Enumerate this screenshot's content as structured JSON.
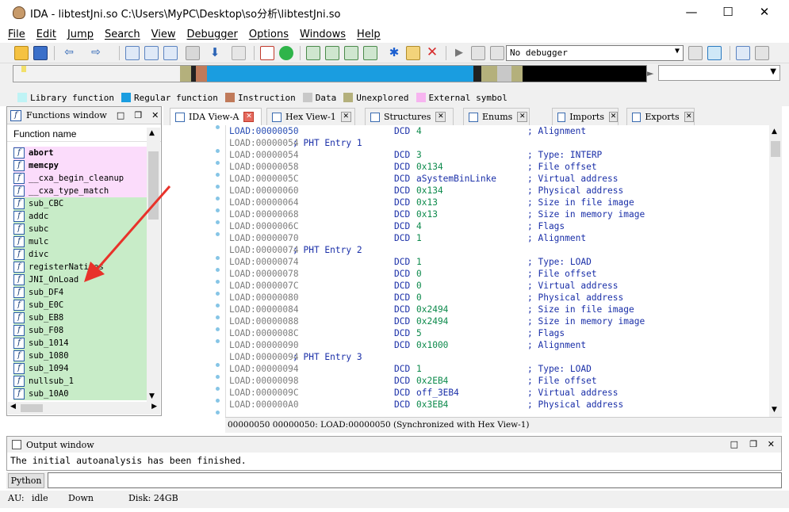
{
  "window": {
    "title": "IDA - libtestJni.so C:\\Users\\MyPC\\Desktop\\so分析\\libtestJni.so"
  },
  "menu": [
    "File",
    "Edit",
    "Jump",
    "Search",
    "View",
    "Debugger",
    "Options",
    "Windows",
    "Help"
  ],
  "toolbar": {
    "debugger_select": "No debugger"
  },
  "legend": [
    {
      "label": "Library function",
      "color": "#bff3f5"
    },
    {
      "label": "Regular function",
      "color": "#1a9de0"
    },
    {
      "label": "Instruction",
      "color": "#c07a5a"
    },
    {
      "label": "Data",
      "color": "#c8c8c8"
    },
    {
      "label": "Unexplored",
      "color": "#b4b07c"
    },
    {
      "label": "External symbol",
      "color": "#f7b4f0"
    }
  ],
  "functions_window": {
    "title": "Functions window",
    "column": "Function name",
    "items": [
      {
        "name": "abort",
        "bg": "#fbdcfb",
        "bold": true
      },
      {
        "name": "memcpy",
        "bg": "#fbdcfb",
        "bold": true
      },
      {
        "name": "__cxa_begin_cleanup",
        "bg": "#fbdcfb",
        "bold": false
      },
      {
        "name": "__cxa_type_match",
        "bg": "#fbdcfb",
        "bold": false
      },
      {
        "name": "sub_CBC",
        "bg": "#c8ecc8",
        "bold": false
      },
      {
        "name": "addc",
        "bg": "#c8ecc8",
        "bold": false
      },
      {
        "name": "subc",
        "bg": "#c8ecc8",
        "bold": false
      },
      {
        "name": "mulc",
        "bg": "#c8ecc8",
        "bold": false
      },
      {
        "name": "divc",
        "bg": "#c8ecc8",
        "bold": false
      },
      {
        "name": "registerNatives",
        "bg": "#c8ecc8",
        "bold": false
      },
      {
        "name": "JNI_OnLoad",
        "bg": "#c8ecc8",
        "bold": false
      },
      {
        "name": "sub_DF4",
        "bg": "#c8ecc8",
        "bold": false
      },
      {
        "name": "sub_E0C",
        "bg": "#c8ecc8",
        "bold": false
      },
      {
        "name": "sub_EB8",
        "bg": "#c8ecc8",
        "bold": false
      },
      {
        "name": "sub_F08",
        "bg": "#c8ecc8",
        "bold": false
      },
      {
        "name": "sub_1014",
        "bg": "#c8ecc8",
        "bold": false
      },
      {
        "name": "sub_1080",
        "bg": "#c8ecc8",
        "bold": false
      },
      {
        "name": "sub_1094",
        "bg": "#c8ecc8",
        "bold": false
      },
      {
        "name": "nullsub_1",
        "bg": "#c8ecc8",
        "bold": false
      },
      {
        "name": "sub_10A0",
        "bg": "#c8ecc8",
        "bold": false
      }
    ]
  },
  "tabs": [
    {
      "label": "IDA View-A",
      "active": true
    },
    {
      "label": "Hex View-1",
      "active": false
    },
    {
      "label": "Structures",
      "active": false
    },
    {
      "label": "Enums",
      "active": false
    },
    {
      "label": "Imports",
      "active": false
    },
    {
      "label": "Exports",
      "active": false
    }
  ],
  "disasm": [
    {
      "addr": "LOAD:00000050",
      "mnem": "DCD",
      "op": "4",
      "cmt": "; Alignment"
    },
    {
      "addr": "LOAD:00000054",
      "hdr": "; PHT Entry 1"
    },
    {
      "addr": "LOAD:00000054",
      "mnem": "DCD",
      "op": "3",
      "cmt": "; Type: INTERP"
    },
    {
      "addr": "LOAD:00000058",
      "mnem": "DCD",
      "op": "0x134",
      "cmt": "; File offset"
    },
    {
      "addr": "LOAD:0000005C",
      "mnem": "DCD",
      "op": "aSystemBinLinke",
      "cmt": "; Virtual address"
    },
    {
      "addr": "LOAD:00000060",
      "mnem": "DCD",
      "op": "0x134",
      "cmt": "; Physical address"
    },
    {
      "addr": "LOAD:00000064",
      "mnem": "DCD",
      "op": "0x13",
      "cmt": "; Size in file image"
    },
    {
      "addr": "LOAD:00000068",
      "mnem": "DCD",
      "op": "0x13",
      "cmt": "; Size in memory image"
    },
    {
      "addr": "LOAD:0000006C",
      "mnem": "DCD",
      "op": "4",
      "cmt": "; Flags"
    },
    {
      "addr": "LOAD:00000070",
      "mnem": "DCD",
      "op": "1",
      "cmt": "; Alignment"
    },
    {
      "addr": "LOAD:00000074",
      "hdr": "; PHT Entry 2"
    },
    {
      "addr": "LOAD:00000074",
      "mnem": "DCD",
      "op": "1",
      "cmt": "; Type: LOAD"
    },
    {
      "addr": "LOAD:00000078",
      "mnem": "DCD",
      "op": "0",
      "cmt": "; File offset"
    },
    {
      "addr": "LOAD:0000007C",
      "mnem": "DCD",
      "op": "0",
      "cmt": "; Virtual address"
    },
    {
      "addr": "LOAD:00000080",
      "mnem": "DCD",
      "op": "0",
      "cmt": "; Physical address"
    },
    {
      "addr": "LOAD:00000084",
      "mnem": "DCD",
      "op": "0x2494",
      "cmt": "; Size in file image"
    },
    {
      "addr": "LOAD:00000088",
      "mnem": "DCD",
      "op": "0x2494",
      "cmt": "; Size in memory image"
    },
    {
      "addr": "LOAD:0000008C",
      "mnem": "DCD",
      "op": "5",
      "cmt": "; Flags"
    },
    {
      "addr": "LOAD:00000090",
      "mnem": "DCD",
      "op": "0x1000",
      "cmt": "; Alignment"
    },
    {
      "addr": "LOAD:00000094",
      "hdr": "; PHT Entry 3"
    },
    {
      "addr": "LOAD:00000094",
      "mnem": "DCD",
      "op": "1",
      "cmt": "; Type: LOAD"
    },
    {
      "addr": "LOAD:00000098",
      "mnem": "DCD",
      "op": "0x2EB4",
      "cmt": "; File offset"
    },
    {
      "addr": "LOAD:0000009C",
      "mnem": "DCD",
      "op": "off_3EB4",
      "cmt": "; Virtual address"
    },
    {
      "addr": "LOAD:000000A0",
      "mnem": "DCD",
      "op": "0x3EB4",
      "cmt": "; Physical address"
    }
  ],
  "sync_status": "00000050 00000050: LOAD:00000050 (Synchronized with Hex View-1)",
  "output_window": {
    "title": "Output window",
    "text": "The initial autoanalysis has been finished."
  },
  "python_button": "Python",
  "statusbar": {
    "au_label": "AU:",
    "au_value": "idle",
    "direction": "Down",
    "disk": "Disk: 24GB"
  }
}
